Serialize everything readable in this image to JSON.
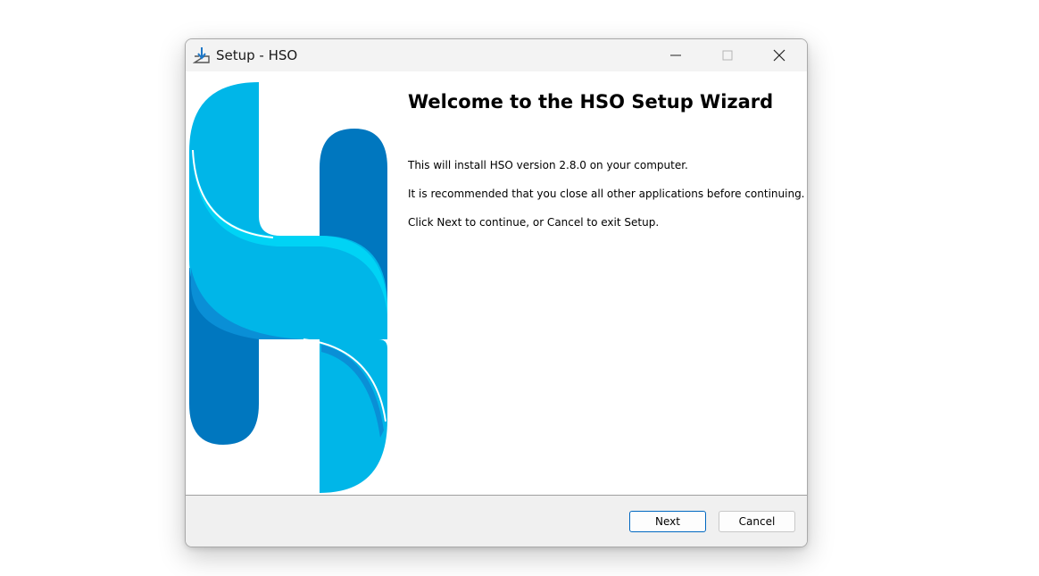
{
  "window": {
    "title": "Setup - HSO"
  },
  "main": {
    "heading": "Welcome to the HSO Setup Wizard",
    "paragraphs": [
      "This will install HSO version 2.8.0 on your computer.",
      "It is recommended that you close all other applications before continuing.",
      "Click Next to continue, or Cancel to exit Setup."
    ]
  },
  "buttons": {
    "next": "Next",
    "cancel": "Cancel"
  },
  "icons": {
    "app": "installer-download-icon",
    "minimize": "minimize-icon",
    "maximize": "maximize-icon",
    "close": "close-icon",
    "logo": "hso-logo"
  },
  "colors": {
    "accent": "#0067c0",
    "logo_light": "#00b6e8",
    "logo_dark": "#0077bf",
    "logo_cyan": "#00d3f5"
  }
}
